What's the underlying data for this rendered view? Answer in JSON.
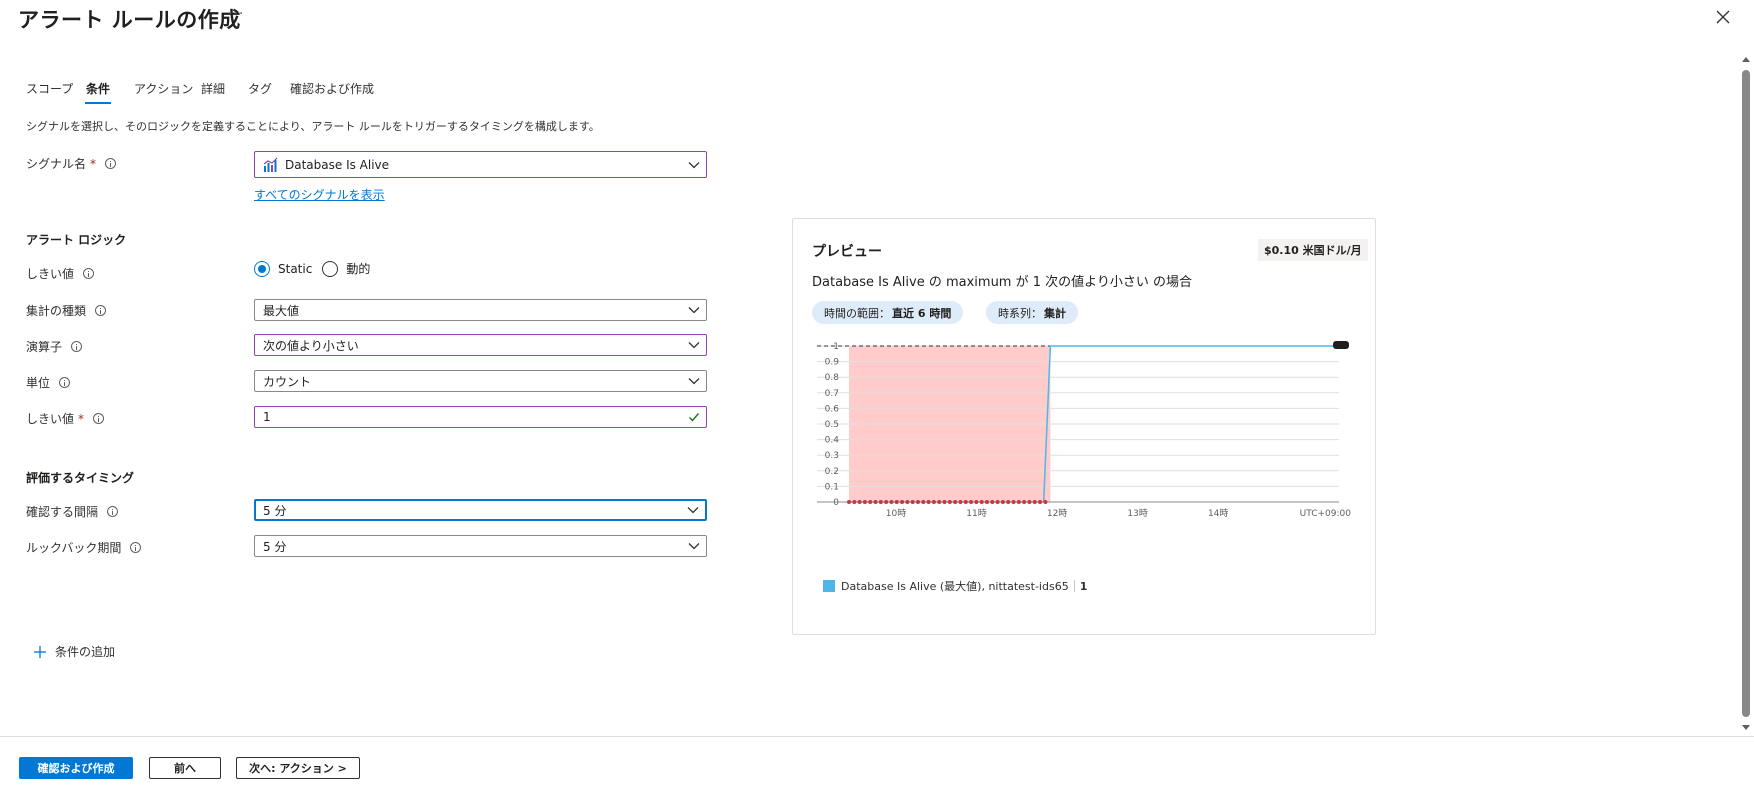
{
  "header": {
    "title": "アラート ルールの作成",
    "more": "···"
  },
  "tabs": [
    {
      "label": "スコープ"
    },
    {
      "label": "条件"
    },
    {
      "label": "アクション"
    },
    {
      "label": "詳細"
    },
    {
      "label": "タグ"
    },
    {
      "label": "確認および作成"
    }
  ],
  "description": "シグナルを選択し、そのロジックを定義することにより、アラート ルールをトリガーするタイミングを構成します。",
  "signal": {
    "label": "シグナル名",
    "required_mark": "*",
    "value": "Database Is Alive",
    "show_all_link": "すべてのシグナルを表示"
  },
  "alert_logic": {
    "section_title": "アラート ロジック",
    "threshold_type_label": "しきい値",
    "threshold_options": [
      "Static",
      "動的"
    ],
    "aggregation_label": "集計の種類",
    "aggregation_value": "最大値",
    "operator_label": "演算子",
    "operator_value": "次の値より小さい",
    "unit_label": "単位",
    "unit_value": "カウント",
    "threshold_value_label": "しきい値",
    "threshold_required_mark": "*",
    "threshold_value": "1"
  },
  "evaluation": {
    "section_title": "評価するタイミング",
    "frequency_label": "確認する間隔",
    "frequency_value": "5 分",
    "lookback_label": "ルックバック期間",
    "lookback_value": "5 分"
  },
  "add_condition": "条件の追加",
  "preview": {
    "title": "プレビュー",
    "cost": "$0.10 米国ドル/月",
    "description": "Database Is Alive の maximum が 1 次の値より小さい の場合",
    "time_range_label": "時間の範囲：",
    "time_range_value": "直近 6 時間",
    "series_label": "時系列：",
    "series_value": "集計",
    "legend_name": "Database Is Alive (最大値), nittatest-ids65",
    "legend_value": "1",
    "timezone": "UTC+09:00"
  },
  "chart_data": {
    "type": "line",
    "x_ticks": [
      "10時",
      "11時",
      "12時",
      "13時",
      "14時"
    ],
    "y_ticks": [
      "0",
      "0.1",
      "0.2",
      "0.3",
      "0.4",
      "0.5",
      "0.6",
      "0.7",
      "0.8",
      "0.9",
      "1"
    ],
    "ylim": [
      0,
      1
    ],
    "threshold": 1,
    "alert_region": {
      "from": "09:25",
      "to": "11:55"
    },
    "series": [
      {
        "name": "Database Is Alive (最大値), nittatest-ids65",
        "points": [
          {
            "x": "09:25",
            "y": 0
          },
          {
            "x": "11:50",
            "y": 0
          },
          {
            "x": "11:55",
            "y": 1
          },
          {
            "x": "15:30",
            "y": 1
          }
        ],
        "color": "#4cb7e8"
      }
    ],
    "alert_marker_color": "#d13438",
    "alert_fill_color": "#ffcccb"
  },
  "footer": {
    "review_create": "確認および作成",
    "previous": "前へ",
    "next": "次へ: アクション >"
  },
  "colors": {
    "accent": "#0078d4",
    "field_highlight": "#8e44ad",
    "valid_check": "#107c10"
  }
}
